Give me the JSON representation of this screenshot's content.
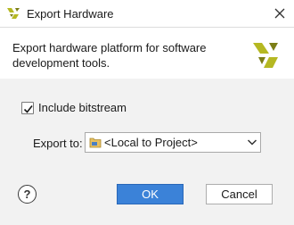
{
  "window": {
    "title": "Export Hardware",
    "icon": "xilinx-logo-icon",
    "close_icon": "close-icon"
  },
  "header": {
    "description": "Export hardware platform for software development tools.",
    "logo": "xilinx-logo-icon"
  },
  "options": {
    "include_bitstream": {
      "label": "Include bitstream",
      "checked": true
    },
    "export_to": {
      "label": "Export to:",
      "value": "<Local to Project>",
      "icon": "folder-icon"
    }
  },
  "footer": {
    "help_label": "?",
    "ok_label": "OK",
    "cancel_label": "Cancel"
  },
  "colors": {
    "ok_button_bg": "#3b82d8",
    "body_bg": "#f2f2f2",
    "logo_primary": "#b5b822",
    "logo_dark": "#7c7e16"
  }
}
